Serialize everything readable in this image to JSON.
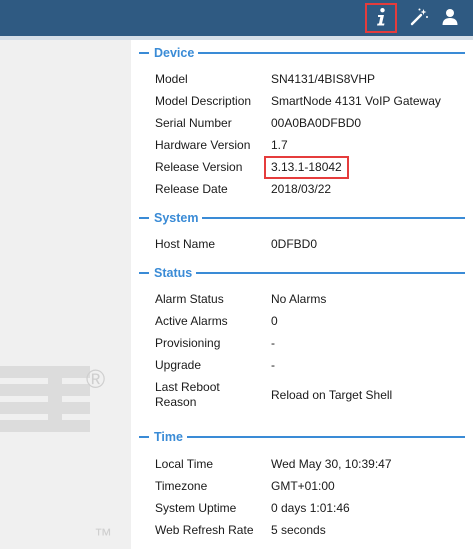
{
  "header": {
    "icons": {
      "info": "info-icon",
      "wand": "magic-wand-icon",
      "user": "user-icon"
    }
  },
  "watermark": {
    "registered": "®",
    "trademark": "™"
  },
  "colors": {
    "header_bg": "#2f5a82",
    "section_accent": "#3a8bd6",
    "highlight": "#e53c3c",
    "left_panel": "#f0f0f0"
  },
  "sections": {
    "device": {
      "title": "Device",
      "rows": [
        {
          "label": "Model",
          "value": "SN4131/4BIS8VHP"
        },
        {
          "label": "Model Description",
          "value": "SmartNode 4131 VoIP Gateway"
        },
        {
          "label": "Serial Number",
          "value": "00A0BA0DFBD0"
        },
        {
          "label": "Hardware Version",
          "value": "1.7"
        },
        {
          "label": "Release Version",
          "value": "3.13.1-18042"
        },
        {
          "label": "Release Date",
          "value": "2018/03/22"
        }
      ]
    },
    "system": {
      "title": "System",
      "rows": [
        {
          "label": "Host Name",
          "value": "0DFBD0"
        }
      ]
    },
    "status": {
      "title": "Status",
      "rows": [
        {
          "label": "Alarm Status",
          "value": "No Alarms"
        },
        {
          "label": "Active Alarms",
          "value": "0"
        },
        {
          "label": "Provisioning",
          "value": "-"
        },
        {
          "label": "Upgrade",
          "value": "-"
        },
        {
          "label": "Last Reboot Reason",
          "value": "Reload on Target Shell"
        }
      ]
    },
    "time": {
      "title": "Time",
      "rows": [
        {
          "label": "Local Time",
          "value": "Wed May 30, 10:39:47"
        },
        {
          "label": "Timezone",
          "value": "GMT+01:00"
        },
        {
          "label": "System Uptime",
          "value": "0 days 1:01:46"
        },
        {
          "label": "Web Refresh Rate",
          "value": "5 seconds"
        }
      ]
    }
  }
}
